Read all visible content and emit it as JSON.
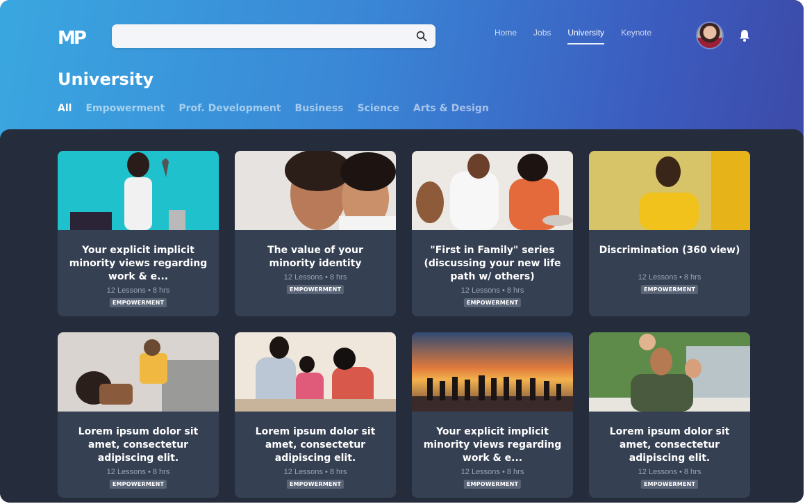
{
  "brand": {
    "logo": "MP"
  },
  "search": {
    "value": "",
    "placeholder": ""
  },
  "nav": {
    "items": [
      "Home",
      "Jobs",
      "University",
      "Keynote"
    ],
    "active": "University"
  },
  "page": {
    "title": "University"
  },
  "categories": [
    "All",
    "Empowerment",
    "Prof. Development",
    "Business",
    "Science",
    "Arts & Design"
  ],
  "cards": [
    {
      "title": "Your explicit implicit minority views regarding work & e...",
      "meta": "12 Lessons • 8 hrs",
      "badge": "EMPOWERMENT"
    },
    {
      "title": "The value of your minority identity",
      "meta": "12 Lessons • 8 hrs",
      "badge": "EMPOWERMENT"
    },
    {
      "title": "\"First in Family\" series (discussing your new life path w/ others)",
      "meta": "12 Lessons • 8 hrs",
      "badge": "EMPOWERMENT"
    },
    {
      "title": "Discrimination (360 view)",
      "meta": "12 Lessons • 8 hrs",
      "badge": "EMPOWERMENT"
    },
    {
      "title": "Lorem ipsum dolor sit amet, consectetur adipiscing elit.",
      "meta": "12 Lessons • 8 hrs",
      "badge": "EMPOWERMENT"
    },
    {
      "title": "Lorem ipsum dolor sit amet, consectetur adipiscing elit.",
      "meta": "12 Lessons • 8 hrs",
      "badge": "EMPOWERMENT"
    },
    {
      "title": "Your explicit implicit minority views regarding work & e...",
      "meta": "12 Lessons • 8 hrs",
      "badge": "EMPOWERMENT"
    },
    {
      "title": "Lorem ipsum dolor sit amet, consectetur adipiscing elit.",
      "meta": "12 Lessons • 8 hrs",
      "badge": "EMPOWERMENT"
    }
  ],
  "colors": {
    "hero_start": "#3aa7e0",
    "hero_end": "#3d4aa8",
    "panel": "#252c3c",
    "card": "#364053",
    "badge": "#5a6477"
  }
}
